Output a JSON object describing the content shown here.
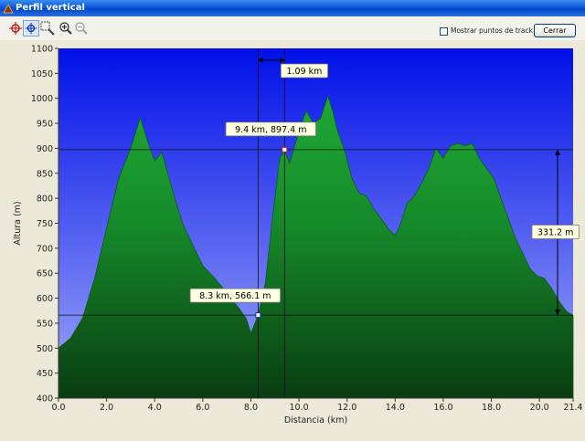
{
  "window": {
    "title": "Perfil vertical"
  },
  "toolbar": {
    "tools": [
      {
        "name": "crosshair-red-icon"
      },
      {
        "name": "crosshair-blue-icon"
      },
      {
        "name": "zoom-select-icon"
      },
      {
        "name": "zoom-in-icon"
      },
      {
        "name": "zoom-out-icon"
      }
    ],
    "show_points_label": "Mostrar puntos de track",
    "show_points_checked": false,
    "close_label": "Cerrar"
  },
  "colors": {
    "sky_top": "#0010e8",
    "sky_bottom": "#9fa8f8",
    "terrain_light": "#22b43a",
    "terrain_dark": "#0a3d12",
    "title_bar": "#0a58d6",
    "callout_bg": "#ffffe1"
  },
  "chart_data": {
    "type": "area",
    "title": "",
    "xlabel": "Distancia  (km)",
    "ylabel": "Altura  (m)",
    "xlim": [
      0,
      21.4
    ],
    "ylim": [
      400,
      1100
    ],
    "x_ticks": [
      "0.0",
      "2.0",
      "4.0",
      "6.0",
      "8.0",
      "10.0",
      "12.0",
      "14.0",
      "16.0",
      "18.0",
      "20.0",
      "21.4"
    ],
    "x_tick_values": [
      0,
      2,
      4,
      6,
      8,
      10,
      12,
      14,
      16,
      18,
      20,
      21.4
    ],
    "y_ticks": [
      "400",
      "450",
      "500",
      "550",
      "600",
      "650",
      "700",
      "750",
      "800",
      "850",
      "900",
      "950",
      "1000",
      "1050",
      "1100"
    ],
    "y_tick_values": [
      400,
      450,
      500,
      550,
      600,
      650,
      700,
      750,
      800,
      850,
      900,
      950,
      1000,
      1050,
      1100
    ],
    "grid": false,
    "x": [
      0,
      0.5,
      1,
      1.5,
      2,
      2.5,
      3,
      3.2,
      3.4,
      3.6,
      3.8,
      4,
      4.3,
      4.6,
      4.9,
      5.2,
      5.6,
      6,
      6.5,
      7,
      7.5,
      7.8,
      8.0,
      8.3,
      8.6,
      8.9,
      9.2,
      9.4,
      9.6,
      9.8,
      10,
      10.3,
      10.6,
      10.9,
      11.2,
      11.4,
      11.6,
      11.9,
      12.2,
      12.5,
      12.8,
      13.1,
      13.4,
      13.7,
      14,
      14.2,
      14.5,
      14.8,
      15.1,
      15.4,
      15.7,
      16,
      16.3,
      16.6,
      16.9,
      17.2,
      17.5,
      17.8,
      18.1,
      18.4,
      18.7,
      19,
      19.3,
      19.6,
      19.9,
      20.2,
      20.5,
      20.8,
      21.1,
      21.4
    ],
    "y": [
      500,
      520,
      560,
      640,
      740,
      840,
      900,
      930,
      962,
      930,
      900,
      875,
      892,
      840,
      790,
      745,
      705,
      665,
      640,
      610,
      580,
      560,
      530,
      566,
      630,
      760,
      880,
      897,
      870,
      900,
      935,
      975,
      950,
      960,
      1005,
      975,
      935,
      895,
      840,
      810,
      805,
      780,
      760,
      740,
      725,
      745,
      790,
      805,
      830,
      860,
      900,
      880,
      905,
      910,
      905,
      910,
      880,
      860,
      840,
      800,
      760,
      720,
      690,
      660,
      645,
      640,
      620,
      595,
      575,
      565
    ],
    "annotations": [
      {
        "label": "1.09 km",
        "kind": "horizontal-distance"
      },
      {
        "label": "9.4 km, 897.4 m",
        "x": 9.4,
        "y": 897.4
      },
      {
        "label": "8.3 km, 566.1 m",
        "x": 8.3,
        "y": 566.1
      },
      {
        "label": "331.2 m",
        "kind": "vertical-difference"
      }
    ]
  }
}
